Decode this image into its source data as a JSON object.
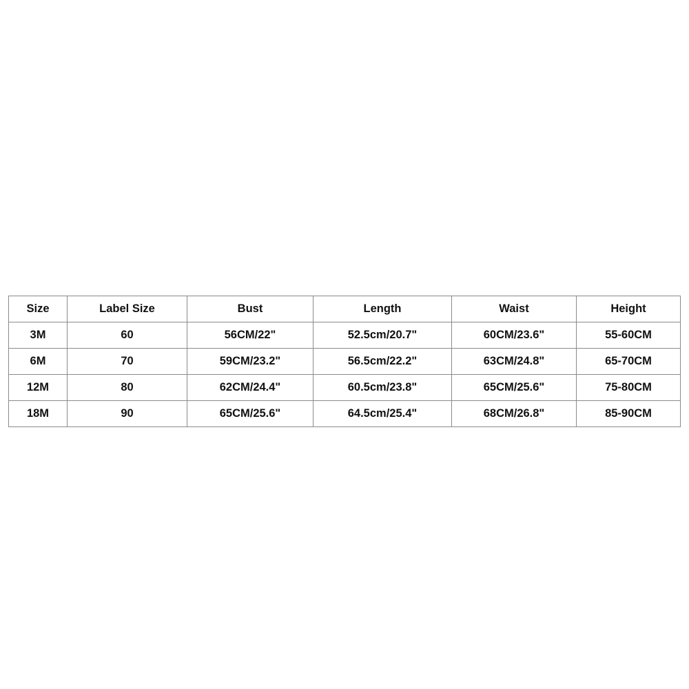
{
  "size_chart": {
    "columns": [
      "Size",
      "Label Size",
      "Bust",
      "Length",
      "Waist",
      "Height"
    ],
    "rows": [
      [
        "3M",
        "60",
        "56CM/22\"",
        "52.5cm/20.7\"",
        "60CM/23.6\"",
        "55-60CM"
      ],
      [
        "6M",
        "70",
        "59CM/23.2\"",
        "56.5cm/22.2\"",
        "63CM/24.8\"",
        "65-70CM"
      ],
      [
        "12M",
        "80",
        "62CM/24.4\"",
        "60.5cm/23.8\"",
        "65CM/25.6\"",
        "75-80CM"
      ],
      [
        "18M",
        "90",
        "65CM/25.6\"",
        "64.5cm/25.4\"",
        "68CM/26.8\"",
        "85-90CM"
      ]
    ]
  },
  "colors": {
    "border": "#8a8a8a",
    "text": "#111111",
    "background": "#ffffff"
  }
}
